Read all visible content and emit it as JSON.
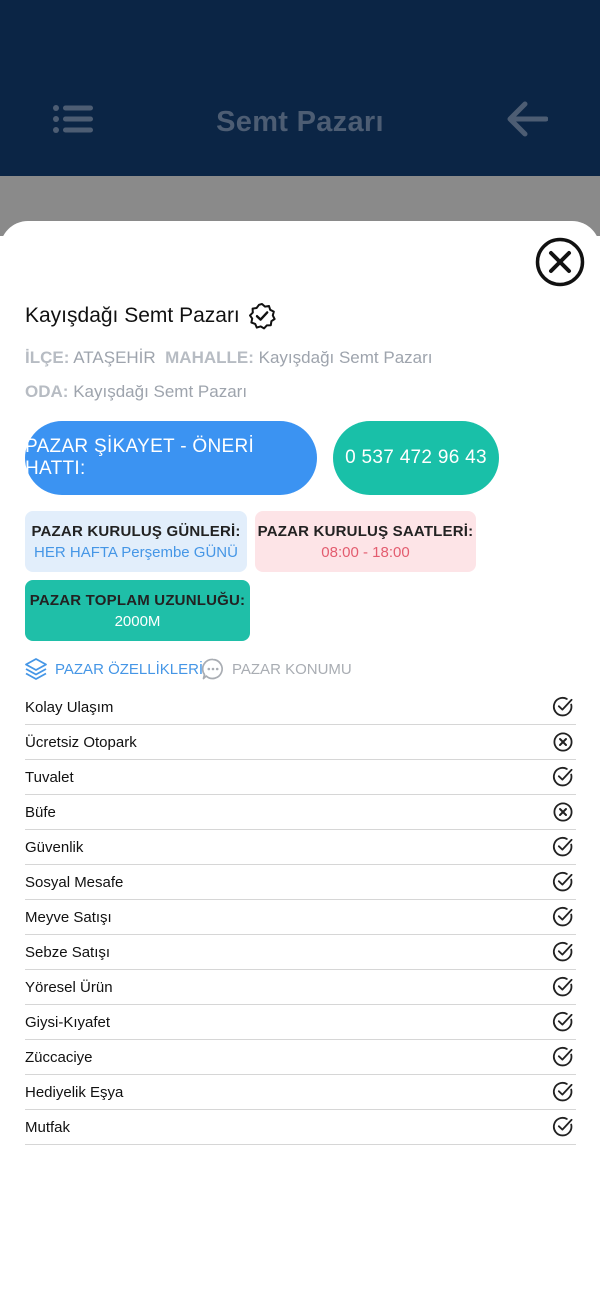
{
  "header": {
    "title": "Semt Pazarı"
  },
  "market": {
    "name": "Kayışdağı Semt Pazarı",
    "ilce_label": "İLÇE:",
    "ilce_value": "ATAŞEHİR",
    "mahalle_label": "MAHALLE:",
    "mahalle_value": "Kayışdağı Semt Pazarı",
    "oda_label": "ODA:",
    "oda_value": "Kayışdağı Semt Pazarı"
  },
  "hotline": {
    "label": "PAZAR ŞİKAYET - ÖNERİ HATTI:",
    "phone": "0 537 472 96 43"
  },
  "cards": {
    "days_label": "PAZAR KURULUŞ GÜNLERİ:",
    "days_value": "HER HAFTA Perşembe GÜNÜ",
    "hours_label": "PAZAR KURULUŞ SAATLERİ:",
    "hours_value": "08:00 - 18:00",
    "length_label": "PAZAR TOPLAM UZUNLUĞU:",
    "length_value": "2000M"
  },
  "tabs": {
    "features": "PAZAR ÖZELLİKLERİ",
    "location": "PAZAR KONUMU"
  },
  "colors": {
    "accent_blue": "#3b93f2",
    "accent_green": "#19c0a8",
    "header_bg": "#0b2545"
  },
  "features": [
    {
      "label": "Kolay Ulaşım",
      "available": true
    },
    {
      "label": "Ücretsiz Otopark",
      "available": false
    },
    {
      "label": "Tuvalet",
      "available": true
    },
    {
      "label": "Büfe",
      "available": false
    },
    {
      "label": "Güvenlik",
      "available": true
    },
    {
      "label": "Sosyal Mesafe",
      "available": true
    },
    {
      "label": "Meyve Satışı",
      "available": true
    },
    {
      "label": "Sebze Satışı",
      "available": true
    },
    {
      "label": "Yöresel Ürün",
      "available": true
    },
    {
      "label": "Giysi-Kıyafet",
      "available": true
    },
    {
      "label": "Züccaciye",
      "available": true
    },
    {
      "label": "Hediyelik Eşya",
      "available": true
    },
    {
      "label": "Mutfak",
      "available": true
    }
  ]
}
